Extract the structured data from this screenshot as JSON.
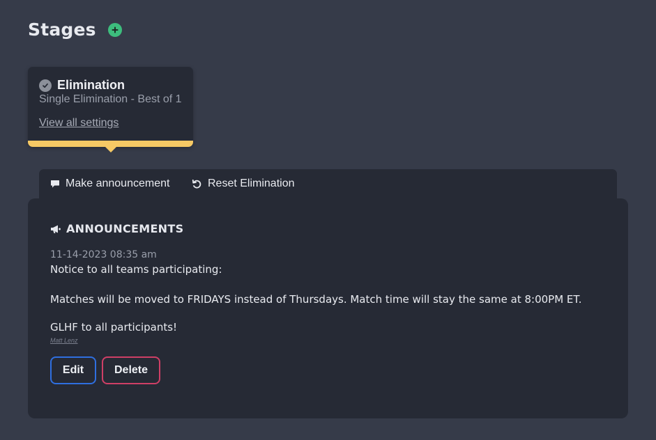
{
  "header": {
    "title": "Stages",
    "add_icon": "plus-circle-icon"
  },
  "stage_card": {
    "name": "Elimination",
    "format": "Single Elimination - Best of 1",
    "link": "View all settings",
    "status_icon": "check-circle-icon",
    "accent_color": "#f6c965"
  },
  "actions": {
    "announce_label": "Make announcement",
    "reset_label": "Reset Elimination"
  },
  "announcements": {
    "title": "ANNOUNCEMENTS",
    "items": [
      {
        "timestamp": "11-14-2023 08:35 am",
        "lines": [
          "Notice to all teams participating:",
          "Matches will be moved to FRIDAYS instead of Thursdays. Match time will stay the same at 8:00PM ET.",
          "GLHF to all participants!"
        ],
        "author": "Matt Lenz",
        "edit_label": "Edit",
        "delete_label": "Delete"
      }
    ]
  },
  "colors": {
    "background": "#363b49",
    "card": "#262a35",
    "add_button": "#3dbd7d",
    "edit_border": "#2f6fe0",
    "delete_border": "#cf3f66"
  }
}
